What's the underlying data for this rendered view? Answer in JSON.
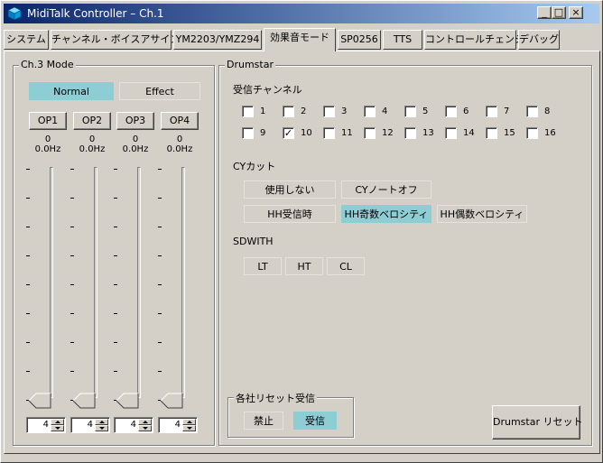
{
  "window": {
    "title": "MidiTalk Controller – Ch.1"
  },
  "title_buttons": {
    "minimize": "_",
    "maximize": "□",
    "close": "×"
  },
  "tabs": [
    {
      "label": "システム"
    },
    {
      "label": "チャンネル・ボイスアサイン"
    },
    {
      "label": "YM2203/YMZ294"
    },
    {
      "label": "効果音モード"
    },
    {
      "label": "SP0256"
    },
    {
      "label": "TTS"
    },
    {
      "label": "コントロールチェンジ"
    },
    {
      "label": "デバッグ"
    }
  ],
  "ch3": {
    "title": "Ch.3 Mode",
    "normal_label": "Normal",
    "effect_label": "Effect",
    "ops": [
      {
        "label": "OP1",
        "value": "0",
        "freq": "0.0Hz",
        "spin": "4",
        "level": 0
      },
      {
        "label": "OP2",
        "value": "0",
        "freq": "0.0Hz",
        "spin": "4",
        "level": 0
      },
      {
        "label": "OP3",
        "value": "0",
        "freq": "0.0Hz",
        "spin": "4",
        "level": 0
      },
      {
        "label": "OP4",
        "value": "0",
        "freq": "0.0Hz",
        "spin": "4",
        "level": 0
      }
    ]
  },
  "drumstar": {
    "title": "Drumstar",
    "channel_label": "受信チャンネル",
    "channels": [
      {
        "label": "1",
        "checked": false
      },
      {
        "label": "2",
        "checked": false
      },
      {
        "label": "3",
        "checked": false
      },
      {
        "label": "4",
        "checked": false
      },
      {
        "label": "5",
        "checked": false
      },
      {
        "label": "6",
        "checked": false
      },
      {
        "label": "7",
        "checked": false
      },
      {
        "label": "8",
        "checked": false
      },
      {
        "label": "9",
        "checked": false
      },
      {
        "label": "10",
        "checked": true
      },
      {
        "label": "11",
        "checked": false
      },
      {
        "label": "12",
        "checked": false
      },
      {
        "label": "13",
        "checked": false
      },
      {
        "label": "14",
        "checked": false
      },
      {
        "label": "15",
        "checked": false
      },
      {
        "label": "16",
        "checked": false
      }
    ],
    "check_mark": "✓",
    "cy_label": "CYカット",
    "cy_options": {
      "unused": "使用しない",
      "cy_note_off": "CYノートオフ",
      "hh_receive": "HH受信時",
      "hh_odd": "HH奇数ベロシティ",
      "hh_even": "HH偶数ベロシティ"
    },
    "sdwith_label": "SDWITH",
    "sdwith_options": {
      "lt": "LT",
      "ht": "HT",
      "cl": "CL"
    },
    "reset_group_title": "各社リセット受信",
    "reset_options": {
      "off": "禁止",
      "on": "受信"
    },
    "reset_button": "Drumstar リセット"
  }
}
